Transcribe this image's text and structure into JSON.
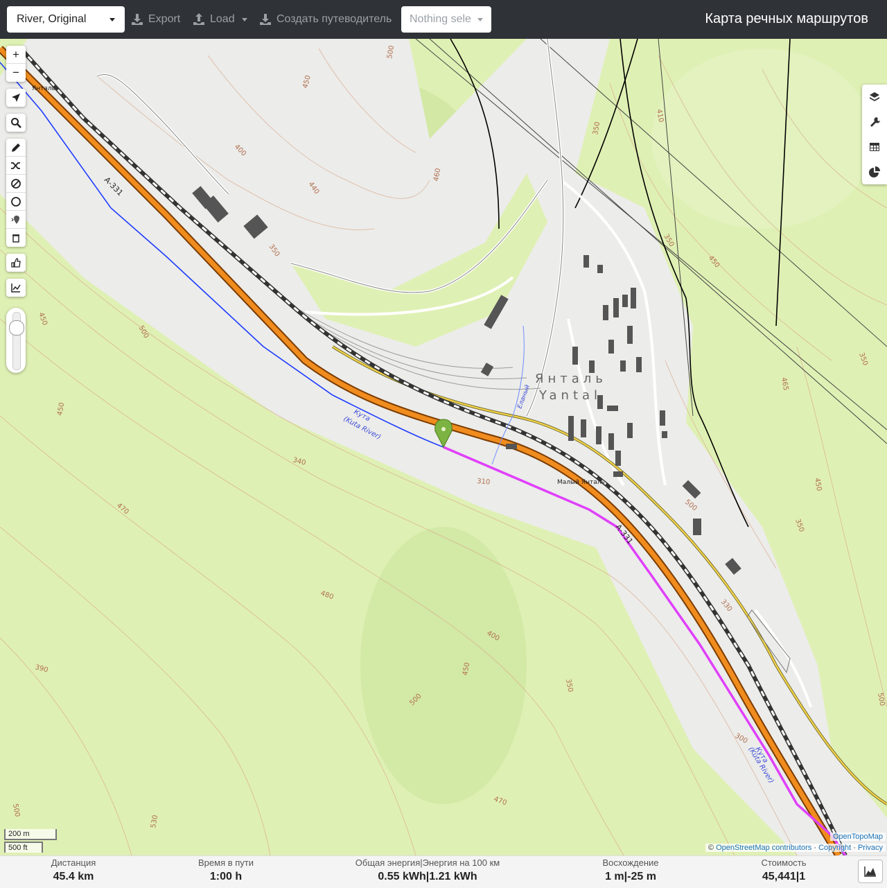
{
  "navbar": {
    "profile": "River, Original",
    "export": "Export",
    "load": "Load",
    "create_guide": "Создать путеводитель",
    "selection": "Nothing sele",
    "title": "Карта речных маршрутов"
  },
  "map": {
    "labels": {
      "town_ru": "Янталь",
      "town_en": "Yantal",
      "station": "Янталь",
      "village": "Малый Янталь",
      "river": "Кута",
      "river_en": "(Kuta River)",
      "river2": "Кута",
      "river2_en": "(Kuta River)",
      "stream": "Еланый",
      "road1": "А-331",
      "road2": "А-331"
    },
    "contours": [
      "500",
      "450",
      "400",
      "440",
      "460",
      "350",
      "410",
      "350",
      "350",
      "450",
      "465",
      "350",
      "450",
      "350",
      "500",
      "450",
      "340",
      "310",
      "470",
      "480",
      "400",
      "450",
      "500",
      "350",
      "330",
      "300",
      "390",
      "470",
      "500",
      "530",
      "500",
      "450",
      "500"
    ]
  },
  "scale": {
    "metric": "200 m",
    "imperial": "500 ft"
  },
  "attribution": {
    "provider": "OpenTopoMap",
    "copy": "©",
    "osm": "OpenStreetMap contributors",
    "sep1": "·",
    "copyright": "Copyright",
    "sep2": "·",
    "privacy": "Privacy"
  },
  "stats": {
    "distance": {
      "label": "Дистанция",
      "value": "45.4 km"
    },
    "time": {
      "label": "Время в пути",
      "value": "1:00 h"
    },
    "energy": {
      "label": "Общая энергия|Энергия на 100 км",
      "value": "0.55 kWh|1.21 kWh"
    },
    "ascent": {
      "label": "Восхождение",
      "value": "1 m|-25 m"
    },
    "cost": {
      "label": "Стоимость",
      "value": "45,441|1"
    }
  },
  "colors": {
    "route": "#e040fb",
    "road": "#f08c1e",
    "river": "#1e3cff",
    "forest": "#dff0b4",
    "valley": "#ececec",
    "marker": "#7cb342"
  },
  "icons": [
    "zoom-in-icon",
    "zoom-out-icon",
    "locate-icon",
    "search-icon",
    "draw-icon",
    "shuffle-icon",
    "no-go-icon",
    "circle-icon",
    "poi-icon",
    "delete-icon",
    "thumb-icon",
    "chart-icon",
    "layers-icon",
    "wrench-icon",
    "table-icon",
    "pie-icon",
    "download-icon",
    "upload-icon",
    "elevation-icon"
  ]
}
